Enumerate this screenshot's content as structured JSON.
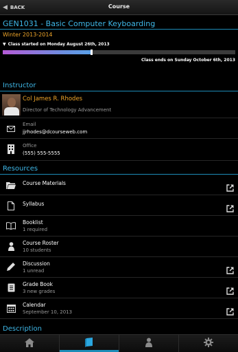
{
  "header": {
    "back_label": "BACK",
    "title": "Course"
  },
  "course": {
    "title": "GEN1031 - Basic Computer Keyboarding",
    "term": "Winter 2013-2014",
    "start_text": "Class started on Monday August 26th, 2013",
    "end_text": "Class ends on Sunday October 6th, 2013",
    "progress_fraction": 0.38
  },
  "instructor": {
    "heading": "Instructor",
    "name": "Col James R. Rhodes",
    "position": "Director of Technology Advancement",
    "email_label": "Email",
    "email": "jjrhodes@dcourseweb.com",
    "office_label": "Office",
    "office": "(555) 555-5555"
  },
  "resources": {
    "heading": "Resources",
    "items": [
      {
        "label": "Course Materials",
        "sub": "",
        "icon": "folder-icon",
        "external": true
      },
      {
        "label": "Syllabus",
        "sub": "",
        "icon": "document-icon",
        "external": true
      },
      {
        "label": "Booklist",
        "sub": "1 required",
        "icon": "book-icon",
        "external": false
      },
      {
        "label": "Course Roster",
        "sub": "10 students",
        "icon": "person-icon",
        "external": false
      },
      {
        "label": "Discussion",
        "sub": "1 unread",
        "icon": "pencil-icon",
        "external": true
      },
      {
        "label": "Grade Book",
        "sub": "3 new grades",
        "icon": "gradebook-icon",
        "external": true
      },
      {
        "label": "Calendar",
        "sub": "September 10, 2013",
        "icon": "calendar-icon",
        "external": true
      }
    ]
  },
  "description": {
    "heading": "Description"
  },
  "tabs": [
    {
      "icon": "home-icon",
      "active": false
    },
    {
      "icon": "course-book-icon",
      "active": true
    },
    {
      "icon": "profile-icon",
      "active": false
    },
    {
      "icon": "settings-gear-icon",
      "active": false
    }
  ],
  "colors": {
    "accent": "#3fb8e8",
    "rule": "#1d8cb8",
    "orange": "#f0a62a",
    "background": "#000000"
  }
}
